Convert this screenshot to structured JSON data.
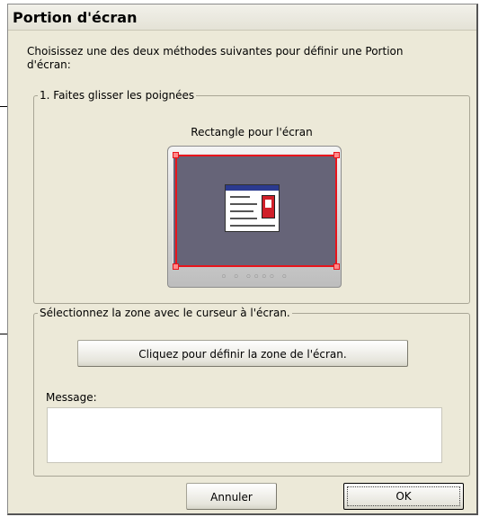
{
  "dialog": {
    "title": "Portion d'écran",
    "intro": "Choisissez une des deux méthodes suivantes pour définir une Portion d'écran:"
  },
  "group_drag": {
    "legend": "1. Faites glisser les poignées",
    "monitor_label": "Rectangle pour l'écran"
  },
  "group_cursor": {
    "legend": "Sélectionnez la zone avec le curseur à l'écran.",
    "define_button": "Cliquez pour définir la zone de l'écran.",
    "message_label": "Message:",
    "message_value": ""
  },
  "footer": {
    "cancel_label": "Annuler",
    "ok_label": "OK"
  },
  "colors": {
    "selection_red": "#e8141c",
    "screen": "#666478",
    "dialog_bg": "#ece9d8"
  }
}
